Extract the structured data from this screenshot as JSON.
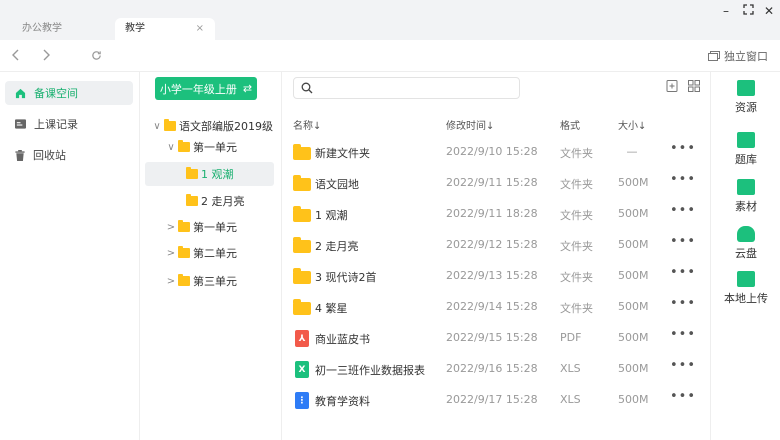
{
  "tabs": [
    {
      "label": "办公教学"
    },
    {
      "label": "教学",
      "close": "×"
    }
  ],
  "window": {
    "minimize": "–",
    "maximize": "⛶",
    "close": "✕"
  },
  "toolbar": {
    "standalone_label": "独立窗口"
  },
  "sidebar": {
    "items": [
      {
        "label": "备课空间",
        "icon": "home-icon"
      },
      {
        "label": "上课记录",
        "icon": "record-icon"
      },
      {
        "label": "回收站",
        "icon": "trash-icon"
      }
    ]
  },
  "tree": {
    "grade_button": "小学一年级上册",
    "grade_swap": "⇄",
    "nodes": [
      {
        "label": "语文部编版2019级",
        "arrow": "∨"
      },
      {
        "label": "第一单元",
        "arrow": "∨"
      },
      {
        "label": "1 观潮",
        "arrow": ""
      },
      {
        "label": "2 走月亮",
        "arrow": ""
      },
      {
        "label": "第一单元",
        "arrow": ">"
      },
      {
        "label": "第二单元",
        "arrow": ">"
      },
      {
        "label": "第三单元",
        "arrow": ">"
      }
    ]
  },
  "main": {
    "search_placeholder": "",
    "headers": {
      "name": "名称↓",
      "time": "修改时间↓",
      "format": "格式",
      "size": "大小↓"
    },
    "rows": [
      {
        "name": "新建文件夹",
        "time": "2022/9/10 15:28",
        "format": "文件夹",
        "size": "—",
        "type": "folder"
      },
      {
        "name": "语文园地",
        "time": "2022/9/11 15:28",
        "format": "文件夹",
        "size": "500M",
        "type": "folder"
      },
      {
        "name": "1 观潮",
        "time": "2022/9/11 18:28",
        "format": "文件夹",
        "size": "500M",
        "type": "folder"
      },
      {
        "name": "2 走月亮",
        "time": "2022/9/12 15:28",
        "format": "文件夹",
        "size": "500M",
        "type": "folder"
      },
      {
        "name": "3 现代诗2首",
        "time": "2022/9/13 15:28",
        "format": "文件夹",
        "size": "500M",
        "type": "folder"
      },
      {
        "name": "4 繁星",
        "time": "2022/9/14 15:28",
        "format": "文件夹",
        "size": "500M",
        "type": "folder"
      },
      {
        "name": "商业蓝皮书",
        "time": "2022/9/15 15:28",
        "format": "PDF",
        "size": "500M",
        "type": "pdf"
      },
      {
        "name": "初一三班作业数据报表",
        "time": "2022/9/16 15:28",
        "format": "XLS",
        "size": "500M",
        "type": "xls"
      },
      {
        "name": "教育学资料",
        "time": "2022/9/17 15:28",
        "format": "XLS",
        "size": "500M",
        "type": "zip"
      }
    ],
    "more": "•••"
  },
  "rightbar": {
    "items": [
      {
        "label": "资源",
        "icon": "resource-icon"
      },
      {
        "label": "题库",
        "icon": "question-bank-icon"
      },
      {
        "label": "素材",
        "icon": "material-icon"
      },
      {
        "label": "云盘",
        "icon": "cloud-icon"
      },
      {
        "label": "本地上传",
        "icon": "upload-icon"
      }
    ]
  },
  "colors": {
    "accent": "#1cc07d",
    "folder": "#ffc21a",
    "pdf": "#f25a4a",
    "xls": "#1cc07d",
    "zip": "#2e7cf6"
  }
}
